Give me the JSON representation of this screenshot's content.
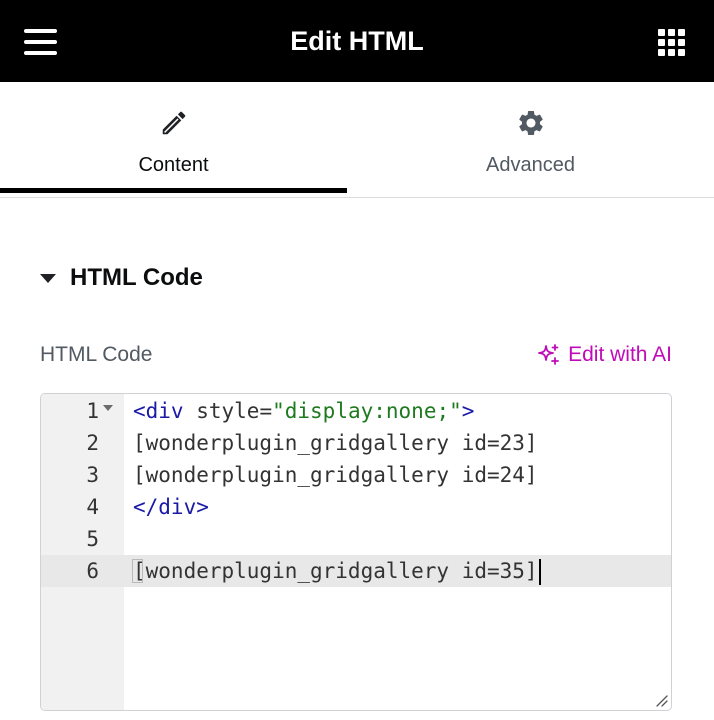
{
  "header": {
    "title": "Edit HTML",
    "menu_icon": "hamburger-icon",
    "apps_icon": "grid-icon"
  },
  "tabs": [
    {
      "label": "Content",
      "icon": "pencil-icon",
      "active": true
    },
    {
      "label": "Advanced",
      "icon": "gear-icon",
      "active": false
    }
  ],
  "section": {
    "title": "HTML Code",
    "expanded": true
  },
  "field": {
    "label": "HTML Code",
    "ai_button_label": "Edit with AI",
    "ai_icon": "sparkle-icon"
  },
  "editor": {
    "active_line": 6,
    "lines": [
      {
        "number": "1",
        "text": "<div style=\"display:none;\">"
      },
      {
        "number": "2",
        "text": "[wonderplugin_gridgallery id=23]"
      },
      {
        "number": "3",
        "text": "[wonderplugin_gridgallery id=24]"
      },
      {
        "number": "4",
        "text": "</div>"
      },
      {
        "number": "5",
        "text": ""
      },
      {
        "number": "6",
        "text": "[wonderplugin_gridgallery id=35]"
      }
    ]
  },
  "colors": {
    "topbar_bg": "#000000",
    "ai_accent": "#c00bb9",
    "tag": "#1a1aa6",
    "string": "#1e7a1e",
    "gutter_bg": "#f1f1f1",
    "active_line_bg": "#e8e8e8"
  }
}
